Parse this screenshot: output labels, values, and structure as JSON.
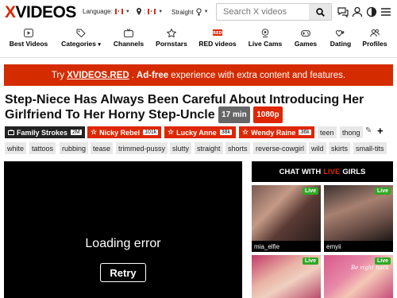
{
  "header": {
    "logo_x": "X",
    "logo_rest": "VIDEOS",
    "language_label": "Language:",
    "location_label": ":",
    "orientation_label": "Straight",
    "search_placeholder": "Search X videos",
    "icons": [
      "search-icon",
      "chat-icon",
      "user-icon",
      "circle-half-icon",
      "menu-icon"
    ]
  },
  "nav": {
    "items": [
      {
        "label": "Best Videos",
        "icon": "play-icon"
      },
      {
        "label": "Categories",
        "icon": "tag-icon",
        "caret": "▾"
      },
      {
        "label": "Channels",
        "icon": "tv-icon"
      },
      {
        "label": "Pornstars",
        "icon": "star-icon"
      },
      {
        "label": "RED videos",
        "icon": "red-badge-icon"
      },
      {
        "label": "Live Cams",
        "icon": "webcam-icon"
      },
      {
        "label": "Games",
        "icon": "gamepad-icon"
      },
      {
        "label": "Dating",
        "icon": "hearts-icon"
      },
      {
        "label": "Profiles",
        "icon": "profiles-icon"
      }
    ]
  },
  "banner": {
    "prefix": "Try",
    "link": "XVIDEOS.RED",
    "adfree": "Ad-free",
    "suffix": "experience with extra content and features."
  },
  "video": {
    "title": "Step-Niece Has Always Been Careful About Introducing Her Girlfriend To Her Horny Step-Uncle",
    "duration": "17 min",
    "quality": "1080p",
    "error_text": "Loading error",
    "retry_label": "Retry"
  },
  "channel": {
    "name": "Family Strokes",
    "count": "2M"
  },
  "models": [
    {
      "name": "Nicky Rebel",
      "count": "101k"
    },
    {
      "name": "Lucky Anne",
      "count": "38k"
    },
    {
      "name": "Wendy Raine",
      "count": "36k"
    }
  ],
  "tags": [
    "teen",
    "thong",
    "white",
    "tattoos",
    "rubbing",
    "tease",
    "trimmed-pussy",
    "slutty",
    "straight",
    "shorts",
    "reverse-cowgirl",
    "wild",
    "skirts",
    "small-tits"
  ],
  "tag_actions": {
    "edit": "✎",
    "add": "+"
  },
  "sidebar": {
    "chat_prefix": "CHAT WITH",
    "chat_live": "LIVE",
    "chat_suffix": "GIRLS",
    "cams": [
      {
        "name": "mia_elfie",
        "live": "Live"
      },
      {
        "name": "emyii",
        "live": "Live"
      },
      {
        "name": "",
        "live": "Live"
      },
      {
        "name": "",
        "live": "Live"
      }
    ],
    "cam4_overlay": "Be right back"
  },
  "colors": {
    "brand": "#de2600",
    "banner": "#d52b00",
    "duration": "#666666",
    "quality": "#de2600",
    "channel": "#222222",
    "model": "#de2600",
    "live": "#2fa824"
  }
}
